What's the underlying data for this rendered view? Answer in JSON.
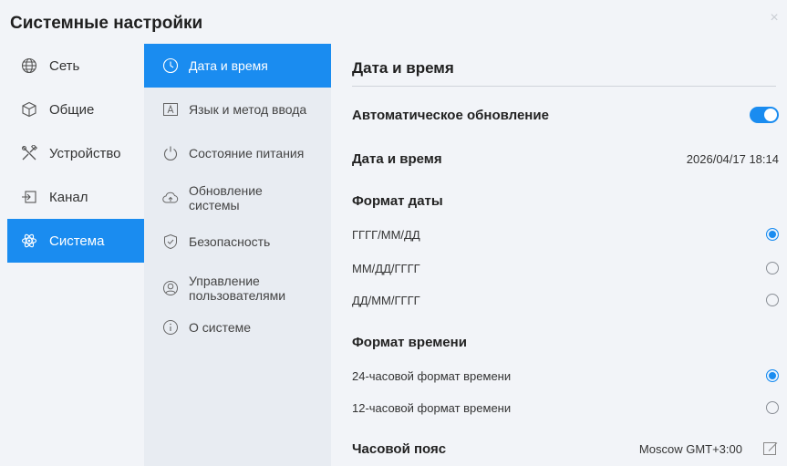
{
  "window": {
    "title": "Системные настройки",
    "close_glyph": "×"
  },
  "nav1": {
    "items": [
      {
        "label": "Сеть",
        "icon": "globe-icon"
      },
      {
        "label": "Общие",
        "icon": "cube-icon"
      },
      {
        "label": "Устройство",
        "icon": "tools-icon"
      },
      {
        "label": "Канал",
        "icon": "input-icon"
      },
      {
        "label": "Система",
        "icon": "atom-icon",
        "active": true
      }
    ]
  },
  "nav2": {
    "items": [
      {
        "label": "Дата и время",
        "icon": "clock-icon",
        "active": true
      },
      {
        "label": "Язык и метод ввода",
        "icon": "language-icon"
      },
      {
        "label": "Состояние питания",
        "icon": "power-icon"
      },
      {
        "label": "Обновление системы",
        "icon": "cloud-upload-icon"
      },
      {
        "label": "Безопасность",
        "icon": "shield-icon"
      },
      {
        "label": "Управление пользователями",
        "icon": "user-icon"
      },
      {
        "label": "О системе",
        "icon": "info-icon"
      }
    ]
  },
  "content": {
    "title": "Дата и время",
    "auto_update_label": "Автоматическое обновление",
    "auto_update_on": true,
    "datetime_label": "Дата и время",
    "datetime_value": "2026/04/17 18:14",
    "date_format_title": "Формат даты",
    "date_formats": [
      "ГГГГ/ММ/ДД",
      "ММ/ДД/ГГГГ",
      "ДД/ММ/ГГГГ"
    ],
    "date_format_selected": 0,
    "time_format_title": "Формат времени",
    "time_formats": [
      "24-часовой формат времени",
      "12-часовой формат времени"
    ],
    "time_format_selected": 0,
    "timezone_label": "Часовой пояс",
    "timezone_value": "Moscow GMT+3:00"
  },
  "colors": {
    "accent": "#1a8cf0",
    "panel": "#f2f4f8",
    "midpanel": "#e8ecf2"
  }
}
